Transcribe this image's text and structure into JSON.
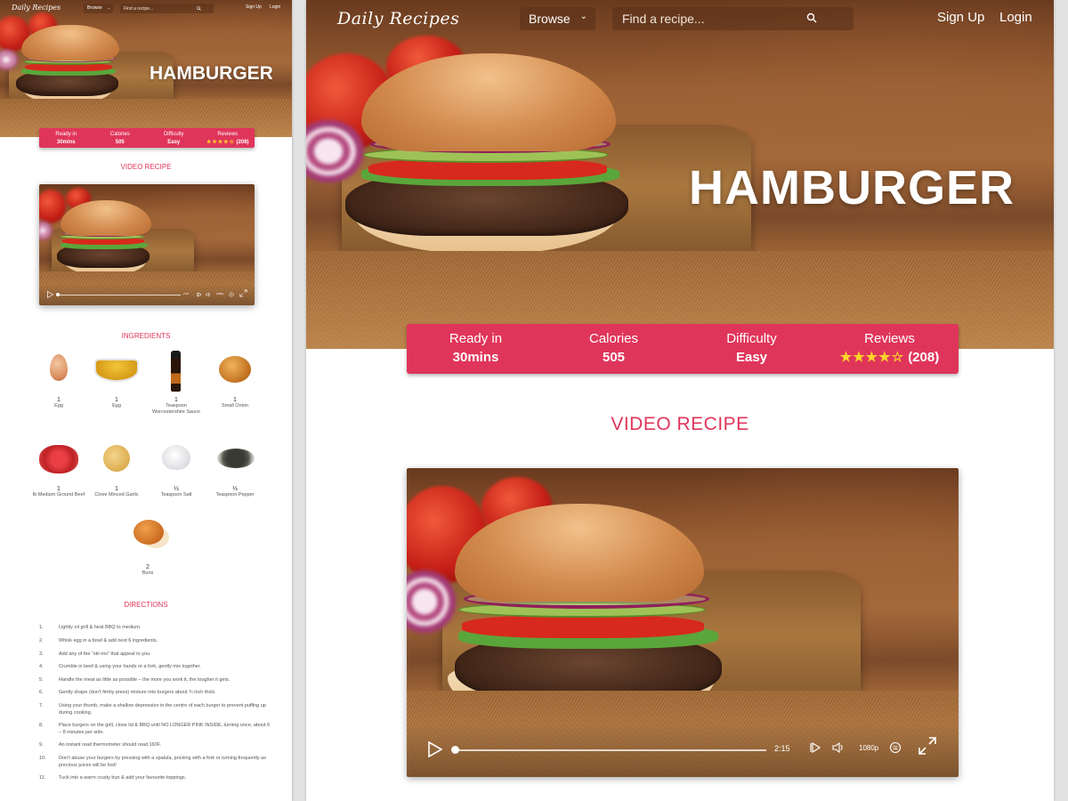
{
  "app": {
    "logo": "Daily Recipes",
    "nav": {
      "browse_label": "Browse",
      "search_placeholder": "Find a recipe...",
      "signup_label": "Sign Up",
      "login_label": "Login"
    }
  },
  "recipe": {
    "title": "HAMBURGER",
    "stats": [
      {
        "label": "Ready in",
        "value": "30mins"
      },
      {
        "label": "Calories",
        "value": "505"
      },
      {
        "label": "Difficulty",
        "value": "Easy"
      },
      {
        "label": "Reviews",
        "rating": 4,
        "rating_max": 5,
        "stars_filled": "★★★★",
        "stars_empty": "☆",
        "count": "(208)"
      }
    ]
  },
  "colors": {
    "accent": "#e0355a",
    "star": "#ffd42a"
  },
  "sections": {
    "video": "VIDEO RECIPE",
    "ingredients": "INGREDIENTS",
    "directions": "DIRECTIONS"
  },
  "video": {
    "duration": "2:15",
    "progress": 0,
    "quality": "1080p",
    "icons": [
      "play-icon",
      "skip-icon",
      "volume-icon",
      "captions-icon",
      "fullscreen-icon"
    ]
  },
  "ingredients": [
    {
      "qty": "1",
      "name": "Egg",
      "icon": "egg"
    },
    {
      "qty": "1",
      "name": "Egg",
      "icon": "mustard"
    },
    {
      "qty": "1",
      "name": "Teaspoon Worcestershire Sauce",
      "icon": "sauce"
    },
    {
      "qty": "1",
      "name": "Small Onion",
      "icon": "onion"
    },
    {
      "qty": "1",
      "name": "lb Medium Ground Beef",
      "icon": "beef"
    },
    {
      "qty": "1",
      "name": "Clove Minced Garlic",
      "icon": "garlic"
    },
    {
      "qty": "½",
      "name": "Teaspoon Salt",
      "icon": "salt"
    },
    {
      "qty": "½",
      "name": "Teaspoon Pepper",
      "icon": "pepper"
    },
    {
      "qty": "2",
      "name": "Buns",
      "icon": "bun"
    }
  ],
  "directions": [
    {
      "num": "1.",
      "text": "Lightly oil grill & heat BBQ to medium."
    },
    {
      "num": "2.",
      "text": "Whisk egg in a bowl & add next 6 ingredients."
    },
    {
      "num": "3.",
      "text": "Add any of the “stir-ins” that appeal to you."
    },
    {
      "num": "4.",
      "text": "Crumble in beef & using your hands or a fork, gently mix together."
    },
    {
      "num": "5.",
      "text": "Handle the meat as little as possible – the more you work it, the tougher it gets."
    },
    {
      "num": "6.",
      "text": "Gently shape (don’t firmly press) mixture into burgers about ¾ inch thick."
    },
    {
      "num": "7.",
      "text": "Using your thumb, make a shallow depression in the centre of each burger to prevent puffing up during cooking."
    },
    {
      "num": "8.",
      "text": "Place burgers on the grill, close lid & BBQ until NO LONGER PINK INSIDE, turning once, about 6 – 8 minutes per side."
    },
    {
      "num": "9.",
      "text": "An instant read thermometer should read 160F."
    },
    {
      "num": "10.",
      "text": "Don’t abuse your burgers by pressing with a spatula, pricking with a fork or turning frequently as precious juices will be lost!"
    },
    {
      "num": "11.",
      "text": "Tuck into a warm crusty bun & add your favourite toppings."
    }
  ]
}
